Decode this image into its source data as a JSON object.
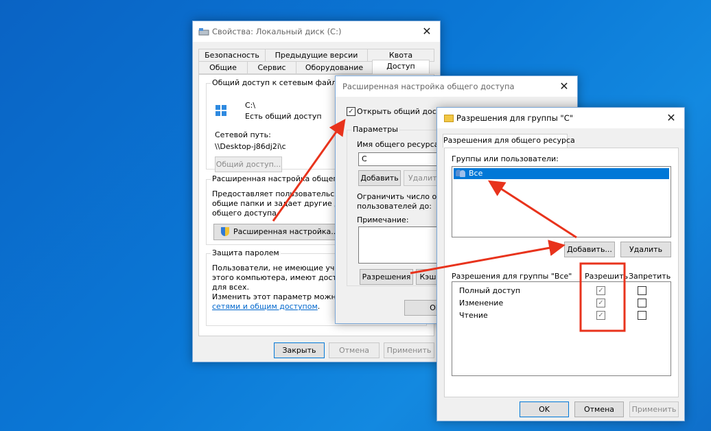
{
  "props_window": {
    "title": "Свойства: Локальный диск (C:)",
    "tabs_row1": [
      "Безопасность",
      "Предыдущие версии",
      "Квота"
    ],
    "tabs_row2": [
      "Общие",
      "Сервис",
      "Оборудование",
      "Доступ"
    ],
    "net_share_caption": "Общий доступ к сетевым файлам и",
    "drive_name": "C:\\",
    "share_status": "Есть общий доступ",
    "net_path_label": "Сетевой путь:",
    "net_path_value": "\\\\Desktop-j86dj2i\\c",
    "share_button": "Общий доступ...",
    "adv_caption": "Расширенная настройка общего до",
    "adv_desc": [
      "Предоставляет пользовательске",
      "общие папки и задает другие допол",
      "общего доступа."
    ],
    "adv_button": "Расширенная настройка...",
    "pwd_caption": "Защита паролем",
    "pwd_desc": [
      "Пользователи, не имеющие учетно",
      "этого компьютера, имеют доступ к",
      "для всех.",
      "Изменить этот параметр можно че"
    ],
    "pwd_link": "сетями и общим доступом",
    "pwd_link_tail": ".",
    "buttons": {
      "close": "Закрыть",
      "cancel": "Отмена",
      "apply": "Применить"
    }
  },
  "adv_window": {
    "title": "Расширенная настройка общего доступа",
    "share_checkbox": "Открыть общий доступ",
    "share_checked": true,
    "params_caption": "Параметры",
    "share_name_label": "Имя общего ресурса:",
    "share_name_value": "C",
    "add_button": "Добавить",
    "remove_button": "Удалить",
    "limit_label": [
      "Ограничить число одн",
      "пользователей до:"
    ],
    "note_label": "Примечание:",
    "permissions_button": "Разрешения",
    "cache_button": "Кэши",
    "ok_button": "OK"
  },
  "perm_window": {
    "title": "Разрешения для группы \"C\"",
    "tab": "Разрешения для общего ресурса",
    "groups_label": "Группы или пользователи:",
    "groups": [
      "Все"
    ],
    "add_button": "Добавить...",
    "remove_button": "Удалить",
    "perm_header": "Разрешения для группы \"Все\"",
    "allow_header": "Разрешить",
    "deny_header": "Запретить",
    "permissions": [
      {
        "name": "Полный доступ",
        "allow": true,
        "deny": false
      },
      {
        "name": "Изменение",
        "allow": true,
        "deny": false
      },
      {
        "name": "Чтение",
        "allow": true,
        "deny": false
      }
    ],
    "ok": "OK",
    "cancel": "Отмена",
    "apply": "Применить"
  },
  "colors": {
    "annotation": "#e8331c",
    "selection": "#0078d7",
    "link": "#0066cc"
  }
}
